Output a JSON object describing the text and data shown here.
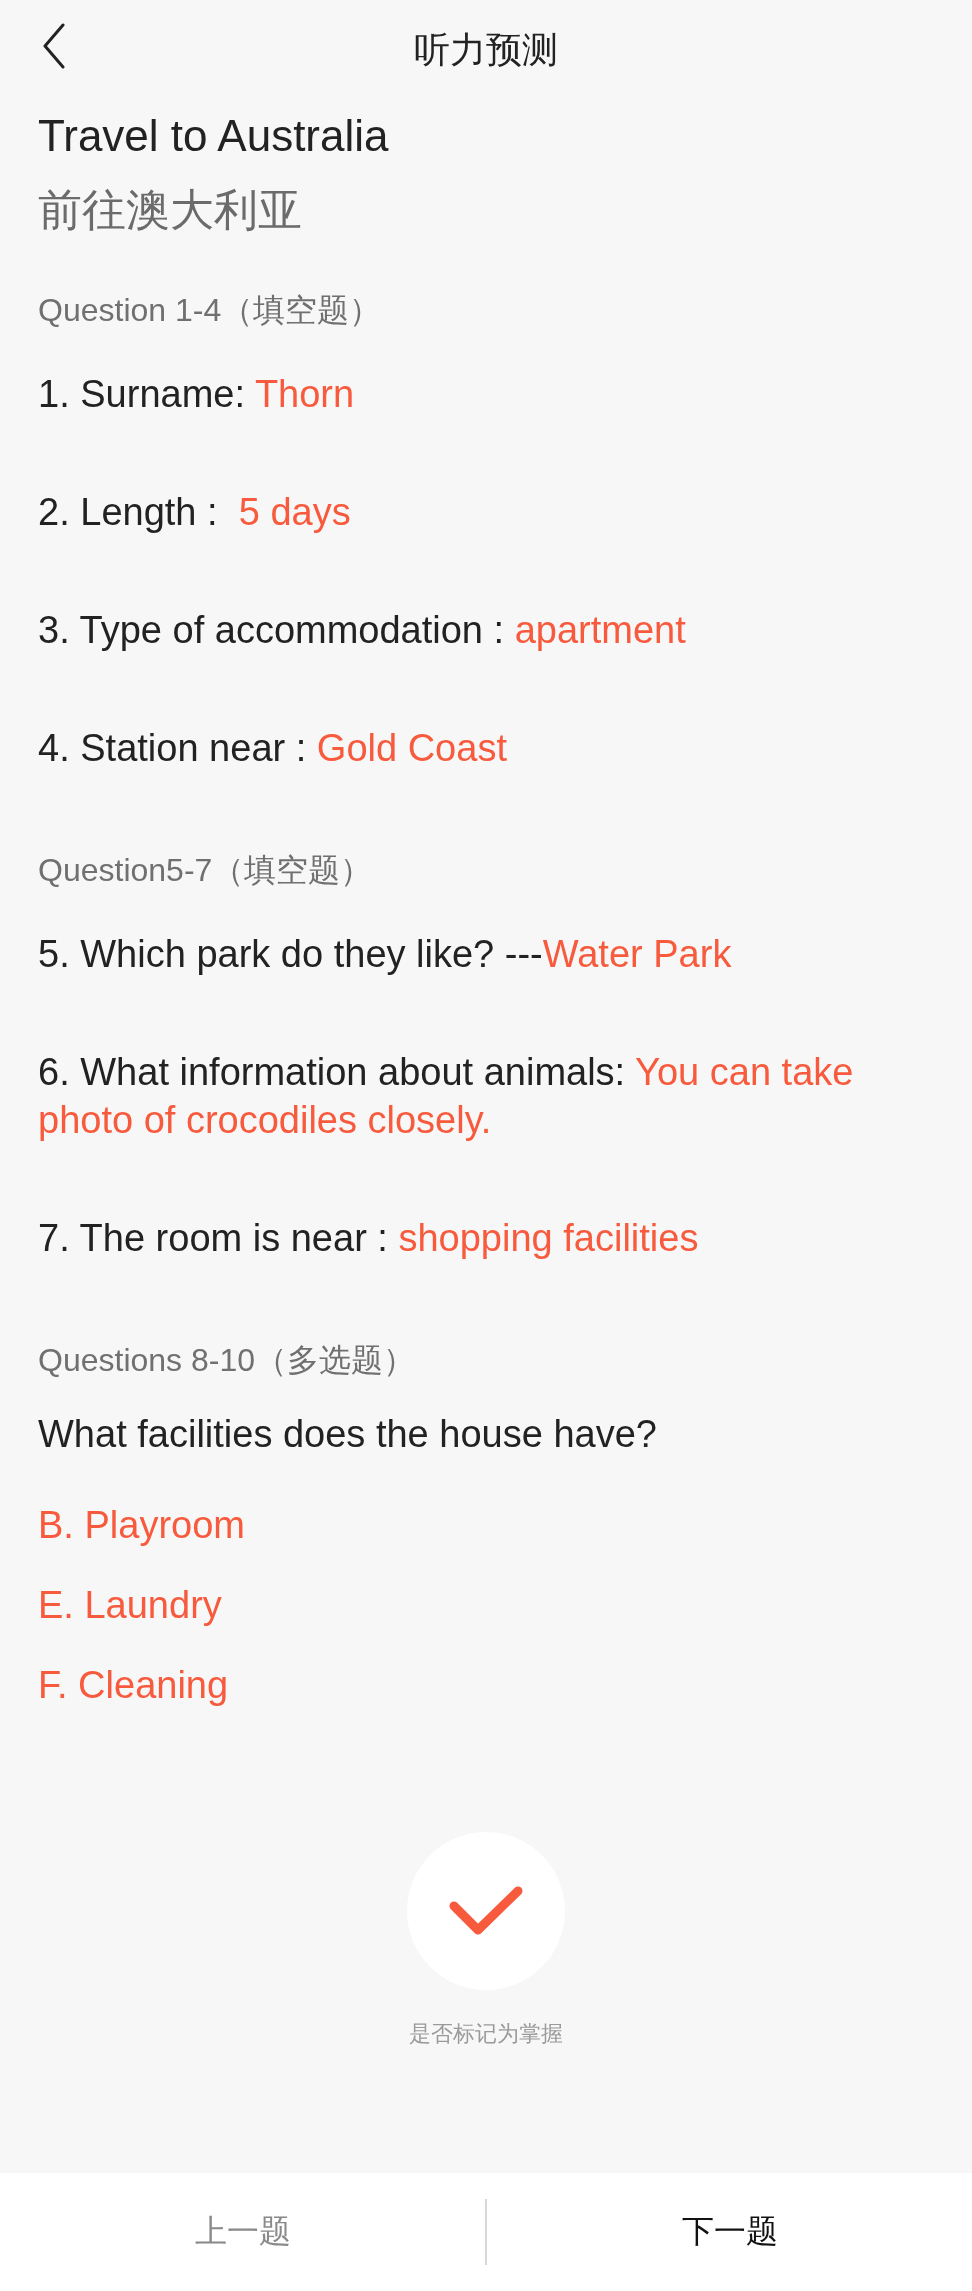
{
  "header": {
    "title": "听力预测"
  },
  "title": "Travel to Australia",
  "subtitle": "前往澳大利亚",
  "sections": [
    {
      "kind": "fill",
      "label": "Question 1-4（填空题）",
      "items": [
        {
          "prompt": "1. Surname: ",
          "answer": "Thorn"
        },
        {
          "prompt": "2. Length :  ",
          "answer": "5 days"
        },
        {
          "prompt": "3. Type of accommodation : ",
          "answer": "apartment"
        },
        {
          "prompt": "4. Station near : ",
          "answer": "Gold Coast"
        }
      ]
    },
    {
      "kind": "fill",
      "label": "Question5-7（填空题）",
      "items": [
        {
          "prompt": "5. Which park do they like? ---",
          "answer": "Water Park"
        },
        {
          "prompt": "6. What information about animals: ",
          "answer": "You can take photo of crocodiles closely."
        },
        {
          "prompt": "7. The room is near : ",
          "answer": "shopping facilities"
        }
      ]
    },
    {
      "kind": "choice",
      "label": "Questions 8-10（多选题）",
      "question": "What facilities does the house have?",
      "answers": [
        "B. Playroom",
        "E. Laundry",
        "F. Cleaning"
      ]
    }
  ],
  "mastery": {
    "label": "是否标记为掌握",
    "checked": true
  },
  "nav": [
    {
      "label": "上一题",
      "disabled": true
    },
    {
      "label": "下一题",
      "disabled": false
    }
  ]
}
